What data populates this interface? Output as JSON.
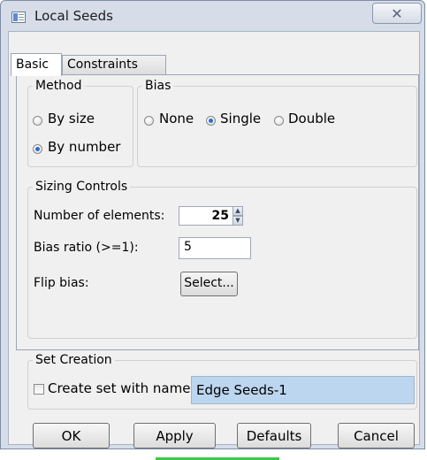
{
  "window": {
    "title": "Local Seeds",
    "close_glyph": "✕"
  },
  "tabs": [
    {
      "label": "Basic",
      "active": true
    },
    {
      "label": "Constraints",
      "active": false
    }
  ],
  "method": {
    "legend": "Method",
    "options": [
      {
        "label": "By size",
        "selected": false
      },
      {
        "label": "By number",
        "selected": true
      }
    ]
  },
  "bias": {
    "legend": "Bias",
    "options": [
      {
        "label": "None",
        "selected": false
      },
      {
        "label": "Single",
        "selected": true
      },
      {
        "label": "Double",
        "selected": false
      }
    ]
  },
  "sizing": {
    "legend": "Sizing Controls",
    "num_elements_label": "Number of elements:",
    "num_elements_value": "25",
    "bias_ratio_label": "Bias ratio (>=1):",
    "bias_ratio_value": "5",
    "flip_bias_label": "Flip bias:",
    "select_button": "Select..."
  },
  "set_creation": {
    "legend": "Set Creation",
    "checkbox_label": "Create set with name:",
    "checked": false,
    "set_name_value": "Edge Seeds-1"
  },
  "buttons": {
    "ok": "OK",
    "apply": "Apply",
    "defaults": "Defaults",
    "cancel": "Cancel"
  },
  "colors": {
    "window_frame": "#d6dde9",
    "highlight_field": "#bcd6f0",
    "radio_dot": "#2b6ed1",
    "progress": "#3cc84b"
  },
  "icons": {
    "app": "app-window-icon",
    "close": "close-icon",
    "spin_up": "spin-up-icon",
    "spin_down": "spin-down-icon"
  }
}
